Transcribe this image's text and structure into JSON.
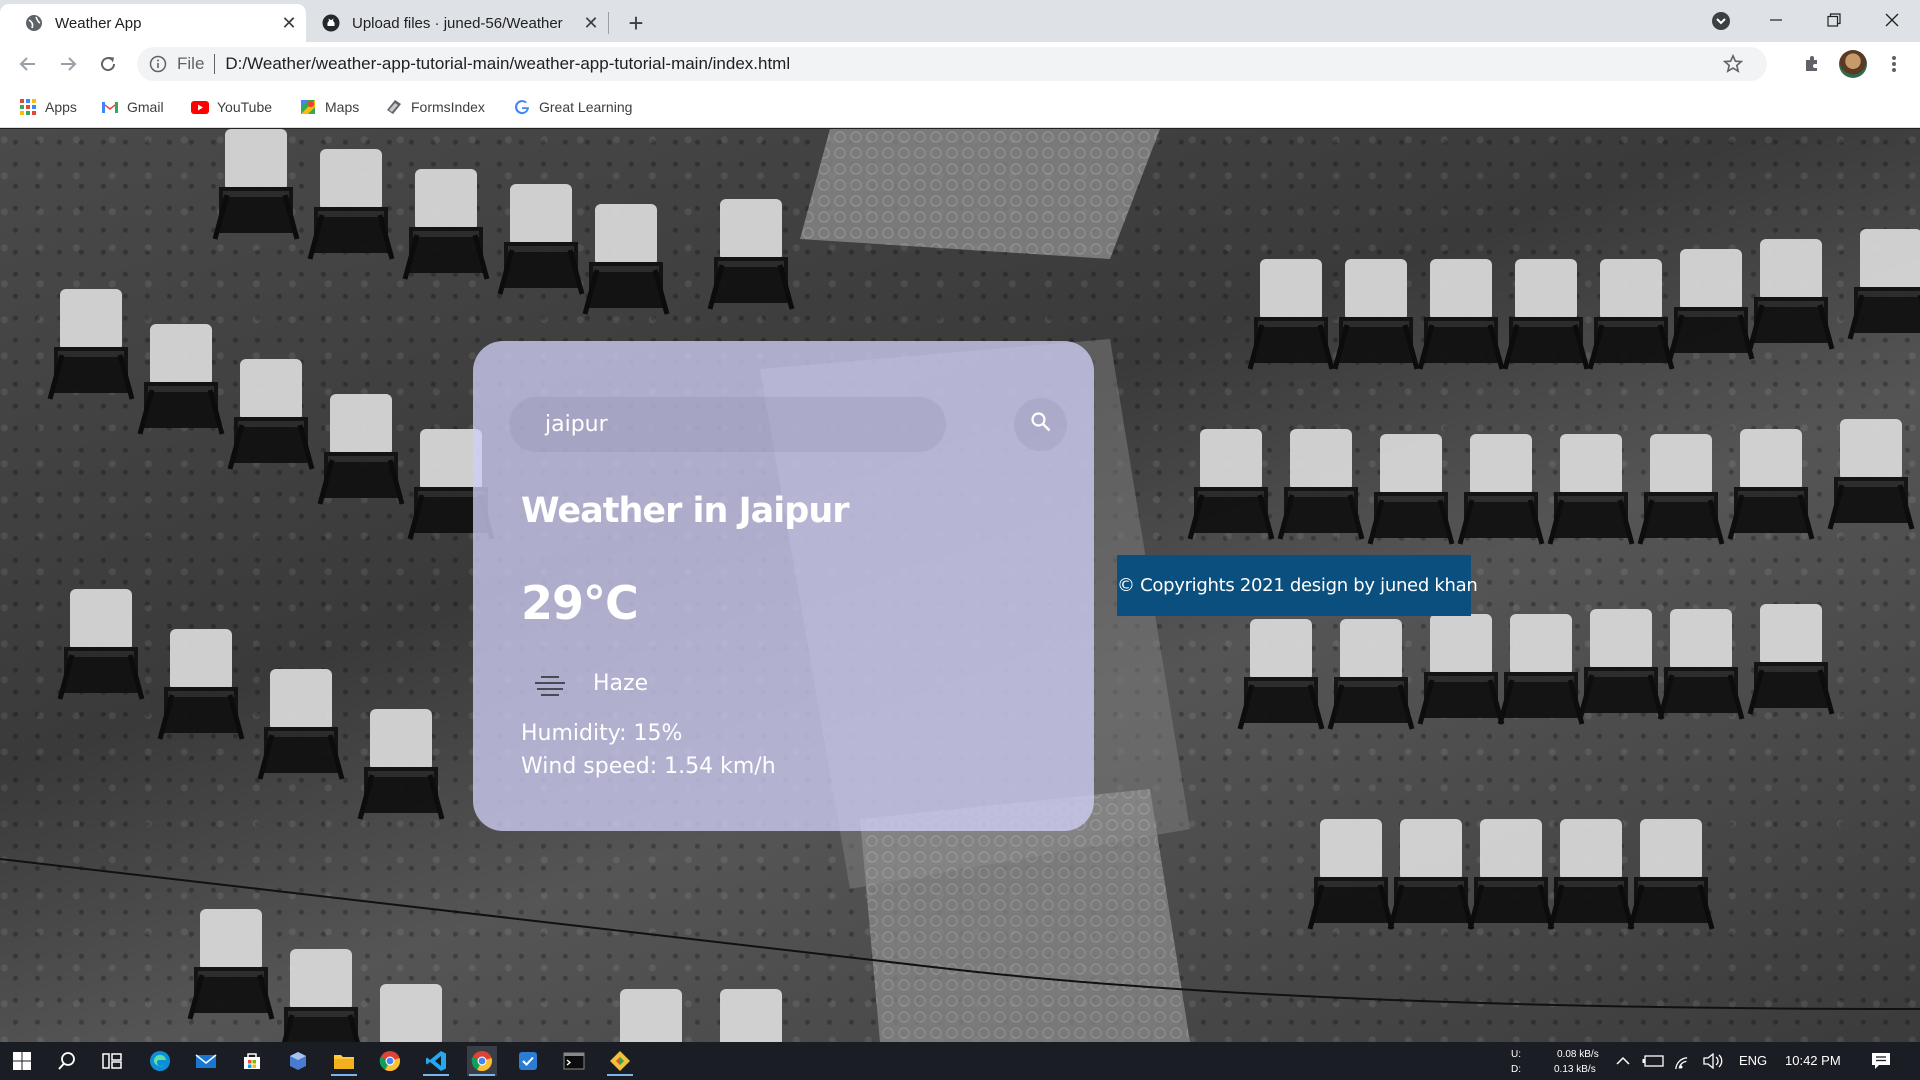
{
  "tabs": [
    {
      "title": "Weather App",
      "icon": "globe-icon",
      "active": true
    },
    {
      "title": "Upload files · juned-56/Weather",
      "icon": "github-icon",
      "active": false
    }
  ],
  "address_bar": {
    "scheme_label": "File",
    "url": "D:/Weather/weather-app-tutorial-main/weather-app-tutorial-main/index.html"
  },
  "bookmarks": [
    {
      "label": "Apps",
      "icon": "apps-grid-icon"
    },
    {
      "label": "Gmail",
      "icon": "gmail-icon"
    },
    {
      "label": "YouTube",
      "icon": "youtube-icon"
    },
    {
      "label": "Maps",
      "icon": "maps-icon"
    },
    {
      "label": "FormsIndex",
      "icon": "formsindex-icon"
    },
    {
      "label": "Great Learning",
      "icon": "google-icon"
    }
  ],
  "weather": {
    "search_value": "jaipur",
    "city_heading": "Weather in Jaipur",
    "temperature": "29°C",
    "description": "Haze",
    "humidity": "Humidity: 15%",
    "wind": "Wind speed: 1.54 km/h"
  },
  "footer": {
    "copyright": "© Copyrights 2021 design by juned khan"
  },
  "taskbar": {
    "net_up_label": "U:",
    "net_down_label": "D:",
    "net_up": "0.08 kB/s",
    "net_down": "0.13 kB/s",
    "language": "ENG",
    "time": "10:42 PM"
  },
  "colors": {
    "card": "#cecef5",
    "copyright_bg": "#0b4f7e",
    "taskbar": "#1b1d24"
  }
}
